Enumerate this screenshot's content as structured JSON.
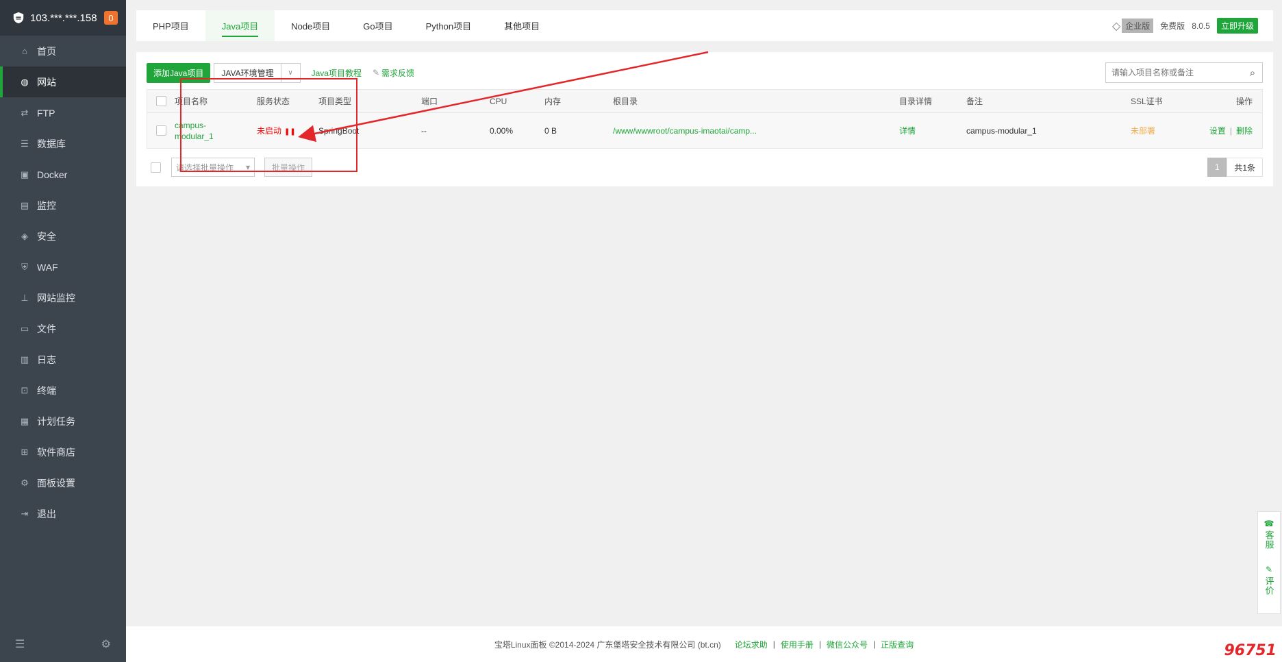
{
  "sidebar": {
    "server_ip": "103.***.***.158",
    "badge_count": "0",
    "items": [
      {
        "label": "首页",
        "icon": "home-icon"
      },
      {
        "label": "网站",
        "icon": "globe-icon"
      },
      {
        "label": "FTP",
        "icon": "ftp-icon"
      },
      {
        "label": "数据库",
        "icon": "database-icon"
      },
      {
        "label": "Docker",
        "icon": "docker-icon"
      },
      {
        "label": "监控",
        "icon": "monitor-icon"
      },
      {
        "label": "安全",
        "icon": "shield-icon"
      },
      {
        "label": "WAF",
        "icon": "waf-icon"
      },
      {
        "label": "网站监控",
        "icon": "chart-icon"
      },
      {
        "label": "文件",
        "icon": "folder-icon"
      },
      {
        "label": "日志",
        "icon": "log-icon"
      },
      {
        "label": "终端",
        "icon": "terminal-icon"
      },
      {
        "label": "计划任务",
        "icon": "calendar-icon"
      },
      {
        "label": "软件商店",
        "icon": "grid-icon"
      },
      {
        "label": "面板设置",
        "icon": "gear-icon"
      },
      {
        "label": "退出",
        "icon": "logout-icon"
      }
    ],
    "active_index": 1
  },
  "tabs": [
    {
      "label": "PHP项目"
    },
    {
      "label": "Java项目"
    },
    {
      "label": "Node项目"
    },
    {
      "label": "Go项目"
    },
    {
      "label": "Python项目"
    },
    {
      "label": "其他项目"
    }
  ],
  "topbar": {
    "enterprise_label": "企业版",
    "free_label": "免费版",
    "version": "8.0.5",
    "upgrade_label": "立即升级"
  },
  "toolbar": {
    "add_label": "添加Java项目",
    "env_label": "JAVA环境管理",
    "tutorial_label": "Java项目教程",
    "feedback_label": "需求反馈",
    "search_placeholder": "请输入项目名称或备注"
  },
  "table": {
    "headers": [
      "项目名称",
      "服务状态",
      "项目类型",
      "端口",
      "CPU",
      "内存",
      "根目录",
      "目录详情",
      "备注",
      "SSL证书",
      "操作"
    ],
    "rows": [
      {
        "name": "campus-modular_1",
        "status": "未启动",
        "type": "SpringBoot",
        "port": "--",
        "cpu": "0.00%",
        "memory": "0 B",
        "root": "/www/wwwroot/campus-imaotai/camp...",
        "detail": "详情",
        "remark": "campus-modular_1",
        "ssl": "未部署",
        "action_settings": "设置",
        "action_separator": "|",
        "action_delete": "删除"
      }
    ]
  },
  "bulk": {
    "select_placeholder": "请选择批量操作",
    "button_label": "批量操作"
  },
  "pager": {
    "current": "1",
    "total_label": "共1条"
  },
  "float_widget": {
    "service_label": "客服",
    "review_label": "评价"
  },
  "footer": {
    "copyright": "宝塔Linux面板 ©2014-2024 广东堡塔安全技术有限公司 (bt.cn)",
    "links": [
      "论坛求助",
      "使用手册",
      "微信公众号",
      "正版查询"
    ],
    "separator": "|"
  },
  "watermark": "96751",
  "colors": {
    "brand_green": "#20a53a",
    "status_red": "#ef0808",
    "ssl_orange": "#f0ad4e",
    "annotation_red": "#e3262a",
    "sidebar_bg": "#3c444d"
  }
}
